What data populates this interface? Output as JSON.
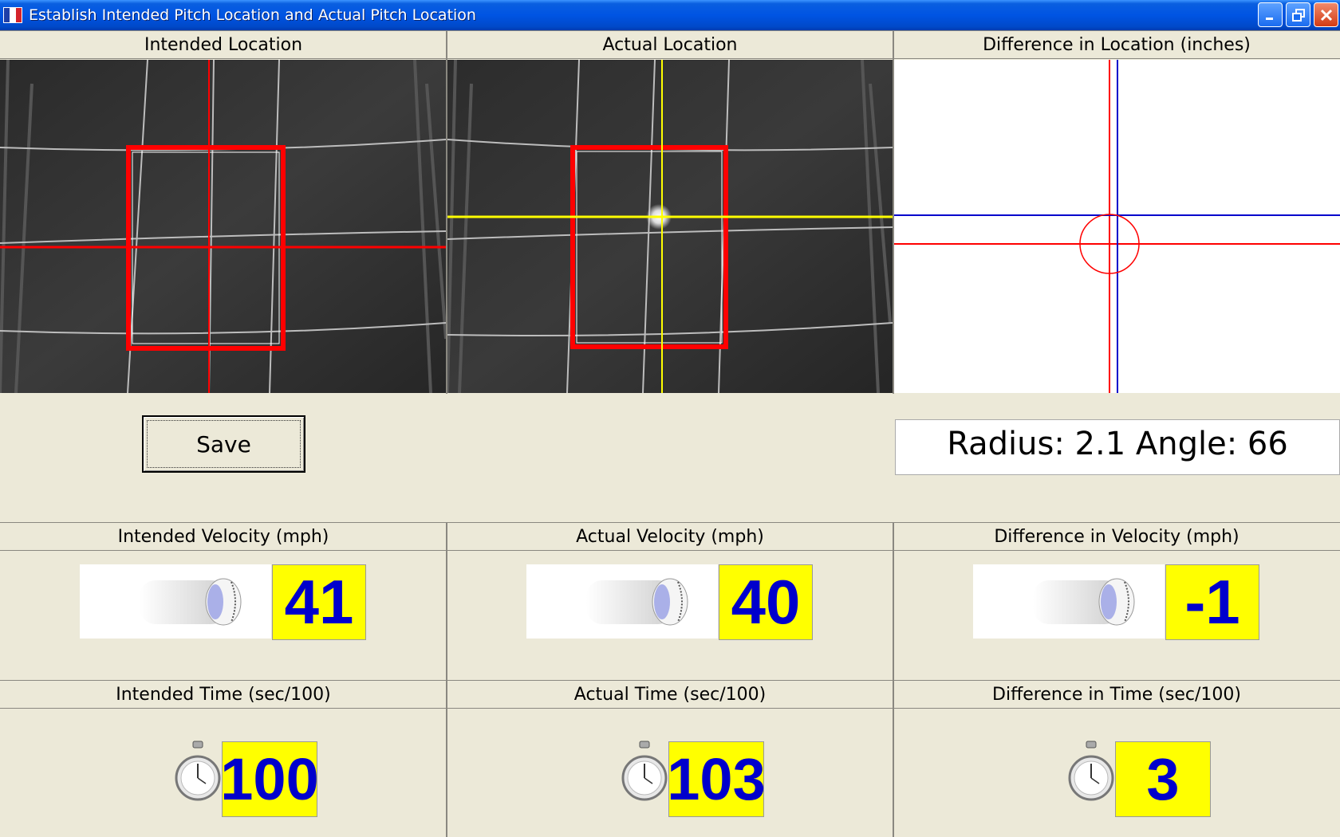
{
  "window": {
    "title": "Establish Intended Pitch Location and Actual Pitch Location"
  },
  "location_headers": {
    "intended": "Intended Location",
    "actual": "Actual Location",
    "difference": "Difference in Location (inches)"
  },
  "save_button": {
    "label": "Save"
  },
  "radius_readout": "Radius: 2.1 Angle: 66",
  "velocity": {
    "intended_header": "Intended Velocity (mph)",
    "actual_header": "Actual Velocity (mph)",
    "difference_header": "Difference in Velocity (mph)",
    "intended_value": "41",
    "actual_value": "40",
    "difference_value": "-1"
  },
  "time": {
    "intended_header": "Intended Time (sec/100)",
    "actual_header": "Actual Time (sec/100)",
    "difference_header": "Difference in Time (sec/100)",
    "intended_value": "100",
    "actual_value": "103",
    "difference_value": "3"
  },
  "colors": {
    "value_background": "#ffff00",
    "value_text": "#0000cc",
    "intended_crosshair": "#ff0000",
    "actual_crosshair": "#ffff00",
    "strike_zone": "#ff0000",
    "difference_blue": "#0000cc"
  },
  "icons": {
    "window_icon": "flag-icon",
    "velocity_icon": "baseball-motion-icon",
    "time_icon": "stopwatch-icon"
  }
}
